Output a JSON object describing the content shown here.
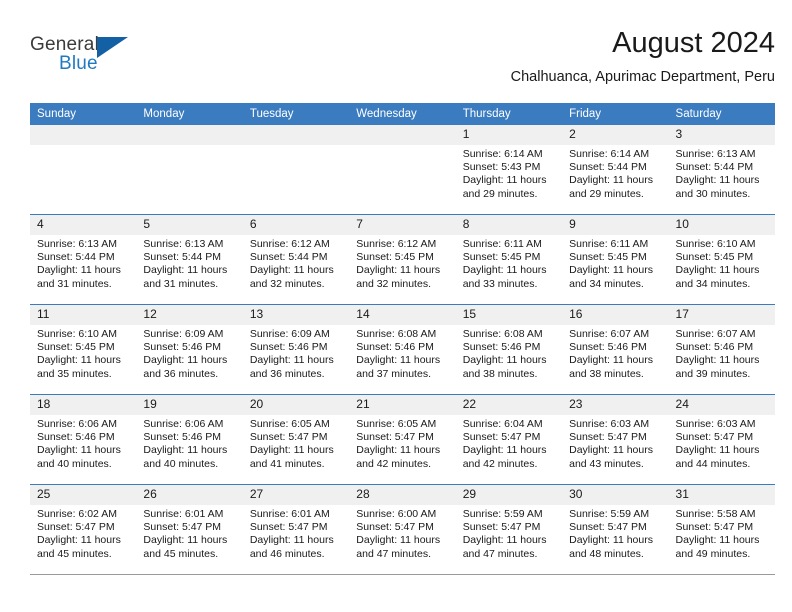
{
  "brand": {
    "name_part1": "General",
    "name_part2": "Blue",
    "flag_icon": "flag-triangle-icon"
  },
  "header": {
    "title": "August 2024",
    "subtitle": "Chalhuanca, Apurimac Department, Peru"
  },
  "theme": {
    "header_blue": "#3b7cc0",
    "brand_blue": "#1f7ac0",
    "flag_blue": "#1361a4",
    "daynum_band": "#f0f0f0"
  },
  "weekdays": [
    "Sunday",
    "Monday",
    "Tuesday",
    "Wednesday",
    "Thursday",
    "Friday",
    "Saturday"
  ],
  "labels": {
    "sunrise_prefix": "Sunrise:",
    "sunset_prefix": "Sunset:",
    "daylight_prefix": "Daylight:"
  },
  "weeks": [
    [
      {
        "day": "",
        "empty": true
      },
      {
        "day": "",
        "empty": true
      },
      {
        "day": "",
        "empty": true
      },
      {
        "day": "",
        "empty": true
      },
      {
        "day": "1",
        "sunrise": "Sunrise: 6:14 AM",
        "sunset": "Sunset: 5:43 PM",
        "daylight": "Daylight: 11 hours and 29 minutes."
      },
      {
        "day": "2",
        "sunrise": "Sunrise: 6:14 AM",
        "sunset": "Sunset: 5:44 PM",
        "daylight": "Daylight: 11 hours and 29 minutes."
      },
      {
        "day": "3",
        "sunrise": "Sunrise: 6:13 AM",
        "sunset": "Sunset: 5:44 PM",
        "daylight": "Daylight: 11 hours and 30 minutes."
      }
    ],
    [
      {
        "day": "4",
        "sunrise": "Sunrise: 6:13 AM",
        "sunset": "Sunset: 5:44 PM",
        "daylight": "Daylight: 11 hours and 31 minutes."
      },
      {
        "day": "5",
        "sunrise": "Sunrise: 6:13 AM",
        "sunset": "Sunset: 5:44 PM",
        "daylight": "Daylight: 11 hours and 31 minutes."
      },
      {
        "day": "6",
        "sunrise": "Sunrise: 6:12 AM",
        "sunset": "Sunset: 5:44 PM",
        "daylight": "Daylight: 11 hours and 32 minutes."
      },
      {
        "day": "7",
        "sunrise": "Sunrise: 6:12 AM",
        "sunset": "Sunset: 5:45 PM",
        "daylight": "Daylight: 11 hours and 32 minutes."
      },
      {
        "day": "8",
        "sunrise": "Sunrise: 6:11 AM",
        "sunset": "Sunset: 5:45 PM",
        "daylight": "Daylight: 11 hours and 33 minutes."
      },
      {
        "day": "9",
        "sunrise": "Sunrise: 6:11 AM",
        "sunset": "Sunset: 5:45 PM",
        "daylight": "Daylight: 11 hours and 34 minutes."
      },
      {
        "day": "10",
        "sunrise": "Sunrise: 6:10 AM",
        "sunset": "Sunset: 5:45 PM",
        "daylight": "Daylight: 11 hours and 34 minutes."
      }
    ],
    [
      {
        "day": "11",
        "sunrise": "Sunrise: 6:10 AM",
        "sunset": "Sunset: 5:45 PM",
        "daylight": "Daylight: 11 hours and 35 minutes."
      },
      {
        "day": "12",
        "sunrise": "Sunrise: 6:09 AM",
        "sunset": "Sunset: 5:46 PM",
        "daylight": "Daylight: 11 hours and 36 minutes."
      },
      {
        "day": "13",
        "sunrise": "Sunrise: 6:09 AM",
        "sunset": "Sunset: 5:46 PM",
        "daylight": "Daylight: 11 hours and 36 minutes."
      },
      {
        "day": "14",
        "sunrise": "Sunrise: 6:08 AM",
        "sunset": "Sunset: 5:46 PM",
        "daylight": "Daylight: 11 hours and 37 minutes."
      },
      {
        "day": "15",
        "sunrise": "Sunrise: 6:08 AM",
        "sunset": "Sunset: 5:46 PM",
        "daylight": "Daylight: 11 hours and 38 minutes."
      },
      {
        "day": "16",
        "sunrise": "Sunrise: 6:07 AM",
        "sunset": "Sunset: 5:46 PM",
        "daylight": "Daylight: 11 hours and 38 minutes."
      },
      {
        "day": "17",
        "sunrise": "Sunrise: 6:07 AM",
        "sunset": "Sunset: 5:46 PM",
        "daylight": "Daylight: 11 hours and 39 minutes."
      }
    ],
    [
      {
        "day": "18",
        "sunrise": "Sunrise: 6:06 AM",
        "sunset": "Sunset: 5:46 PM",
        "daylight": "Daylight: 11 hours and 40 minutes."
      },
      {
        "day": "19",
        "sunrise": "Sunrise: 6:06 AM",
        "sunset": "Sunset: 5:46 PM",
        "daylight": "Daylight: 11 hours and 40 minutes."
      },
      {
        "day": "20",
        "sunrise": "Sunrise: 6:05 AM",
        "sunset": "Sunset: 5:47 PM",
        "daylight": "Daylight: 11 hours and 41 minutes."
      },
      {
        "day": "21",
        "sunrise": "Sunrise: 6:05 AM",
        "sunset": "Sunset: 5:47 PM",
        "daylight": "Daylight: 11 hours and 42 minutes."
      },
      {
        "day": "22",
        "sunrise": "Sunrise: 6:04 AM",
        "sunset": "Sunset: 5:47 PM",
        "daylight": "Daylight: 11 hours and 42 minutes."
      },
      {
        "day": "23",
        "sunrise": "Sunrise: 6:03 AM",
        "sunset": "Sunset: 5:47 PM",
        "daylight": "Daylight: 11 hours and 43 minutes."
      },
      {
        "day": "24",
        "sunrise": "Sunrise: 6:03 AM",
        "sunset": "Sunset: 5:47 PM",
        "daylight": "Daylight: 11 hours and 44 minutes."
      }
    ],
    [
      {
        "day": "25",
        "sunrise": "Sunrise: 6:02 AM",
        "sunset": "Sunset: 5:47 PM",
        "daylight": "Daylight: 11 hours and 45 minutes."
      },
      {
        "day": "26",
        "sunrise": "Sunrise: 6:01 AM",
        "sunset": "Sunset: 5:47 PM",
        "daylight": "Daylight: 11 hours and 45 minutes."
      },
      {
        "day": "27",
        "sunrise": "Sunrise: 6:01 AM",
        "sunset": "Sunset: 5:47 PM",
        "daylight": "Daylight: 11 hours and 46 minutes."
      },
      {
        "day": "28",
        "sunrise": "Sunrise: 6:00 AM",
        "sunset": "Sunset: 5:47 PM",
        "daylight": "Daylight: 11 hours and 47 minutes."
      },
      {
        "day": "29",
        "sunrise": "Sunrise: 5:59 AM",
        "sunset": "Sunset: 5:47 PM",
        "daylight": "Daylight: 11 hours and 47 minutes."
      },
      {
        "day": "30",
        "sunrise": "Sunrise: 5:59 AM",
        "sunset": "Sunset: 5:47 PM",
        "daylight": "Daylight: 11 hours and 48 minutes."
      },
      {
        "day": "31",
        "sunrise": "Sunrise: 5:58 AM",
        "sunset": "Sunset: 5:47 PM",
        "daylight": "Daylight: 11 hours and 49 minutes."
      }
    ]
  ]
}
